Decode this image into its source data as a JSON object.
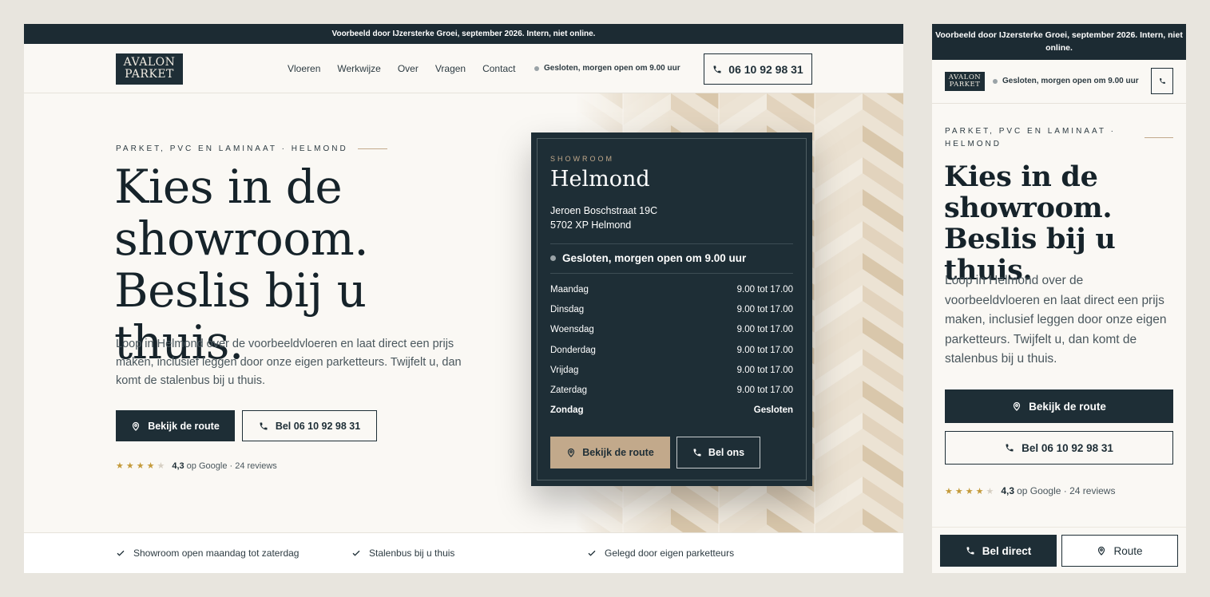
{
  "notice": "Voorbeeld door IJzersterke Groei, september 2026. Intern, niet online.",
  "brand": {
    "line1": "AVALON",
    "line2": "PARKET"
  },
  "nav": [
    "Vloeren",
    "Werkwijze",
    "Over",
    "Vragen",
    "Contact"
  ],
  "status": "Gesloten, morgen open om 9.00 uur",
  "phone": "06 10 92 98 31",
  "hero": {
    "eyebrow": "PARKET, PVC EN LAMINAAT · HELMOND",
    "title": "Kies in de showroom. Beslis bij u thuis.",
    "intro": "Loop in Helmond over de voorbeeldvloeren en laat direct een prijs maken, inclusief leggen door onze eigen parketteurs. Twijfelt u, dan komt de stalenbus bij u thuis.",
    "route_btn": "Bekijk de route",
    "call_btn": "Bel 06 10 92 98 31"
  },
  "rating": {
    "score": "4,3",
    "source": "op Google · 24 reviews",
    "stars": 4
  },
  "card": {
    "label": "SHOWROOM",
    "city": "Helmond",
    "address1": "Jeroen Boschstraat 19C",
    "address2": "5702 XP Helmond",
    "status": "Gesloten, morgen open om 9.00 uur",
    "hours": [
      {
        "day": "Maandag",
        "time": "9.00 tot 17.00"
      },
      {
        "day": "Dinsdag",
        "time": "9.00 tot 17.00"
      },
      {
        "day": "Woensdag",
        "time": "9.00 tot 17.00"
      },
      {
        "day": "Donderdag",
        "time": "9.00 tot 17.00"
      },
      {
        "day": "Vrijdag",
        "time": "9.00 tot 17.00"
      },
      {
        "day": "Zaterdag",
        "time": "9.00 tot 17.00"
      },
      {
        "day": "Zondag",
        "time": "Gesloten"
      }
    ],
    "route_btn": "Bekijk de route",
    "call_btn": "Bel ons"
  },
  "usps": [
    "Showroom open maandag tot zaterdag",
    "Stalenbus bij u thuis",
    "Gelegd door eigen parketteurs"
  ],
  "mobile": {
    "direct_btn": "Bel direct",
    "route_btn": "Route"
  },
  "colors": {
    "dark": "#1e2e36",
    "accent": "#c2a98b",
    "star": "#c49a3a",
    "background": "#faf8f4"
  }
}
